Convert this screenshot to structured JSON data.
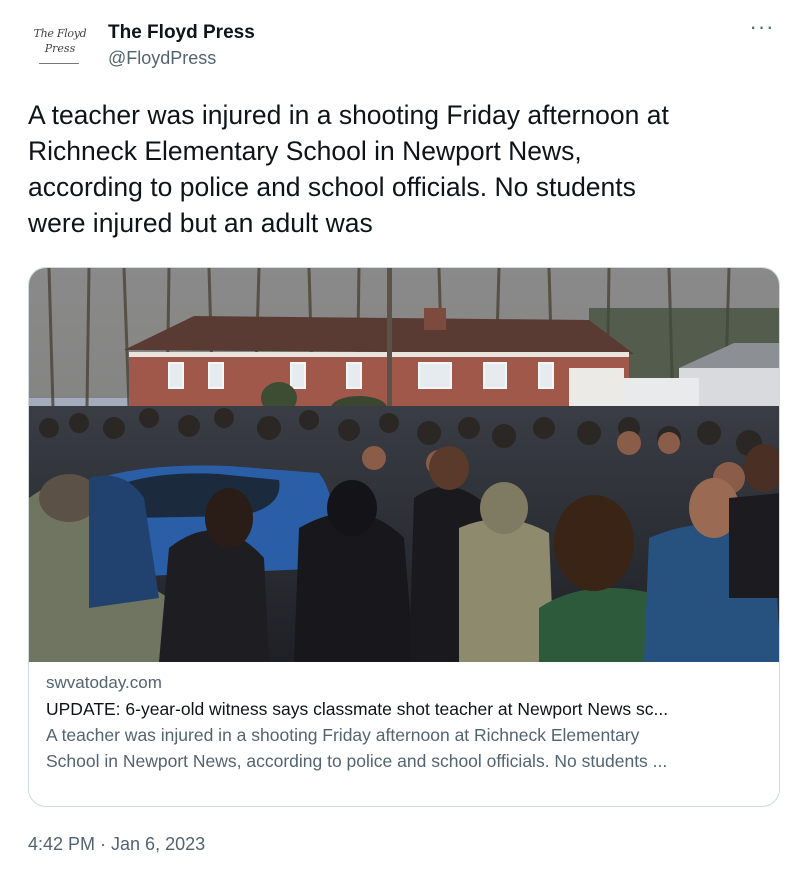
{
  "account": {
    "display_name": "The Floyd Press",
    "handle": "@FloydPress",
    "avatar_text_line1": "The Floyd",
    "avatar_text_line2": "Press"
  },
  "more_icon": "···",
  "tweet": {
    "text": "A teacher was injured in a shooting Friday afternoon at\nRichneck Elementary School in Newport News,\naccording to police and school officials. No students\nwere injured but an adult was",
    "timestamp": "4:42 PM · Jan 6, 2023"
  },
  "card": {
    "image_description": "crowd-photo",
    "domain": "swvatoday.com",
    "title": "UPDATE: 6-year-old witness says classmate shot teacher at Newport News sc...",
    "description": "A teacher was injured in a shooting Friday afternoon at Richneck Elementary\nSchool in Newport News, according to police and school officials. No students ..."
  },
  "colors": {
    "text_primary": "#0f1419",
    "text_secondary": "#536471",
    "border": "#cfd9de"
  }
}
